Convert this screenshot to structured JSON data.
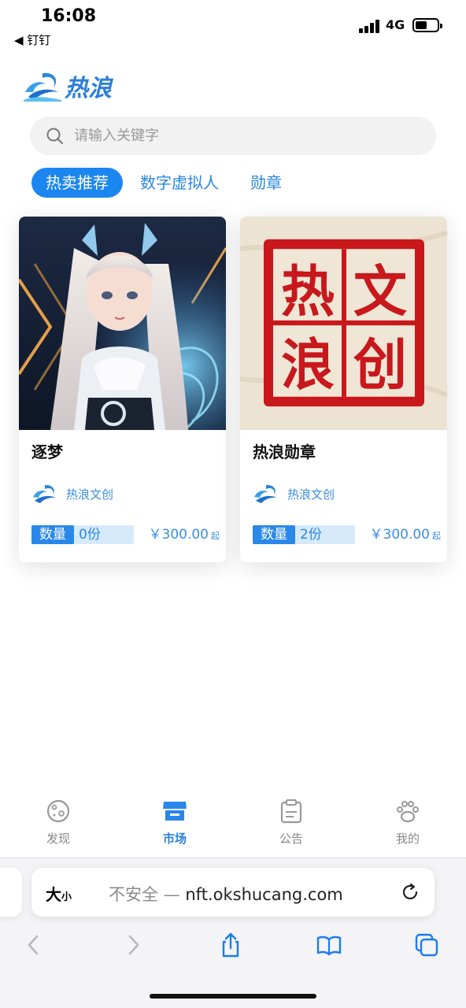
{
  "status_bar": {
    "time": "16:08",
    "back_app": "◀ 钉钉",
    "network": "4G"
  },
  "logo": {
    "text": "热浪",
    "icon": "wave-logo-icon"
  },
  "search": {
    "placeholder": "请输入关键字",
    "value": ""
  },
  "tabs": [
    {
      "label": "热卖推荐",
      "active": true
    },
    {
      "label": "数字虚拟人",
      "active": false
    },
    {
      "label": "勋章",
      "active": false
    }
  ],
  "cards": [
    {
      "title": "逐梦",
      "creator": "热浪文创",
      "qty_label": "数量",
      "qty_value": "0份",
      "price": "￥300.00",
      "price_suffix": "起",
      "image": "anime-girl-illustration"
    },
    {
      "title": "热浪勋章",
      "creator": "热浪文创",
      "qty_label": "数量",
      "qty_value": "2份",
      "price": "￥300.00",
      "price_suffix": "起",
      "image": "red-seal-stamp"
    }
  ],
  "seal_chars": [
    "热",
    "文",
    "浪",
    "创"
  ],
  "bottom_nav": [
    {
      "label": "发现",
      "icon": "planet-icon",
      "active": false
    },
    {
      "label": "市场",
      "icon": "store-icon",
      "active": true
    },
    {
      "label": "公告",
      "icon": "clipboard-icon",
      "active": false
    },
    {
      "label": "我的",
      "icon": "paw-icon",
      "active": false
    }
  ],
  "browser": {
    "text_size_big": "大",
    "text_size_small": "小",
    "insecure_label": "不安全 —",
    "url": "nft.okshucang.com"
  },
  "colors": {
    "accent": "#1c86f0",
    "text_blue": "#3a8ee6",
    "seal_red": "#c8181c"
  }
}
